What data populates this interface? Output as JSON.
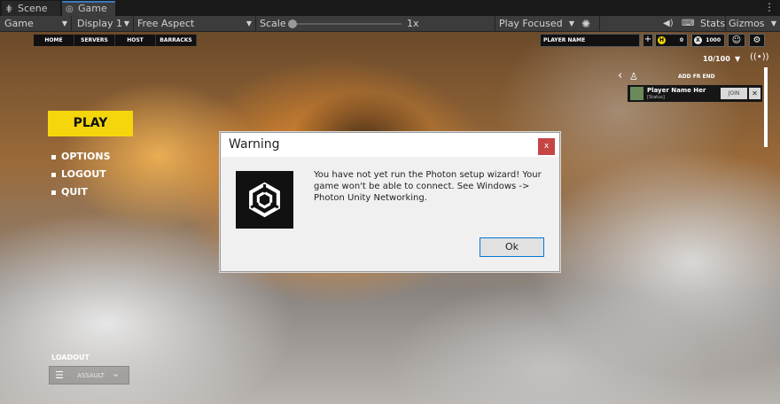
{
  "tabs": {
    "scene": "Scene",
    "game": "Game"
  },
  "toolbar": {
    "game_select": "Game",
    "display": "Display 1",
    "aspect": "Free Aspect",
    "scale_label": "Scale",
    "scale_value": "1x",
    "play_mode": "Play Focused",
    "stats": "Stats",
    "gizmos": "Gizmos"
  },
  "game": {
    "nav": [
      "HOME",
      "SERVERS",
      "HOST",
      "BARRACKS"
    ],
    "player_name": "PLAYER NAME",
    "coins": "0",
    "credits": "1000",
    "coin_glyph": "H",
    "credit_glyph": "X",
    "capacity": "10/100",
    "friends_header": "ADD FR END",
    "friend": {
      "name": "Player Name Her",
      "status": "[Status]",
      "join": "JOIN",
      "remove": "✕"
    },
    "play": "PLAY",
    "menu": [
      "OPTIONS",
      "LOGOUT",
      "QUIT"
    ],
    "loadout_label": "LOADOUT",
    "loadout_value": "ASSAULT"
  },
  "dialog": {
    "title": "Warning",
    "close": "x",
    "message": "You have not yet run the Photon setup wizard! Your game won't be able to connect. See Windows -> Photon Unity Networking.",
    "ok": "Ok"
  },
  "colors": {
    "accent_yellow": "#f5d60c",
    "tab_highlight": "#3a79bb",
    "close_red": "#c54545"
  }
}
